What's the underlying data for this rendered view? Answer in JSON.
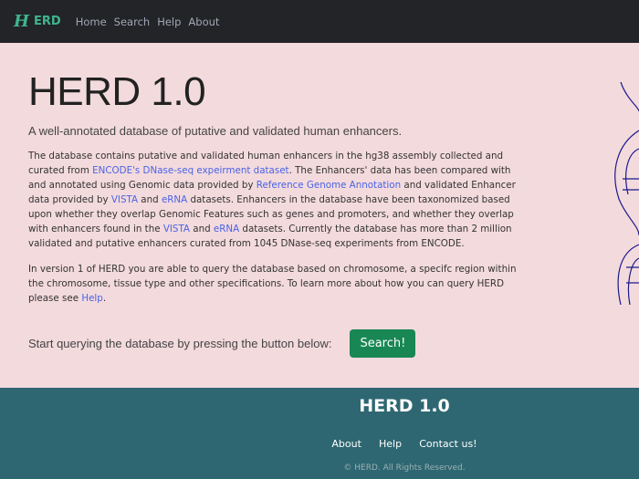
{
  "nav": {
    "logo_h": "H",
    "logo_text": "ERD",
    "links": [
      "Home",
      "Search",
      "Help",
      "About"
    ]
  },
  "hero": {
    "title": "HERD 1.0",
    "lead": "A well-annotated database of putative and validated human enhancers.",
    "p1": [
      {
        "t": "The database contains putative and validated human enhancers in the hg38 assembly collected and curated from "
      },
      {
        "t": "ENCODE's DNase-seq expeirment dataset",
        "link": true
      },
      {
        "t": ". The Enhancers' data has been compared with and annotated using Genomic data provided by "
      },
      {
        "t": "Reference Genome Annotation",
        "link": true
      },
      {
        "t": " and validated Enhancer data provided by "
      },
      {
        "t": "VISTA",
        "link": true
      },
      {
        "t": " and "
      },
      {
        "t": "eRNA",
        "link": true
      },
      {
        "t": " datasets. Enhancers in the database have been taxonomized based upon whether they overlap Genomic Features such as genes and promoters, and whether they overlap with enhancers found in the "
      },
      {
        "t": "VISTA",
        "link": true
      },
      {
        "t": " and "
      },
      {
        "t": "eRNA",
        "link": true
      },
      {
        "t": " datasets. Currently the database has more than 2 million validated and putative enhancers curated from 1045 DNase-seq experiments from ENCODE."
      }
    ],
    "p2": [
      {
        "t": "In version 1 of HERD you are able to query the database based on chromosome, a specifc region within the chromosome, tissue type and other specifications. To learn more about how you can query HERD please see "
      },
      {
        "t": "Help",
        "link": true
      },
      {
        "t": "."
      }
    ]
  },
  "cta": {
    "text": "Start querying the database by pressing the button below:",
    "button": "Search!"
  },
  "footer": {
    "title": "HERD 1.0",
    "links": [
      "About",
      "Help",
      "Contact us!"
    ],
    "copyright": "© HERD. All Rights Reserved."
  },
  "colors": {
    "nav": "#222428",
    "bg": "#f3dadd",
    "footer": "#2e6772",
    "accent": "#3fb58c",
    "link": "#4a63e6",
    "button": "#198754"
  }
}
